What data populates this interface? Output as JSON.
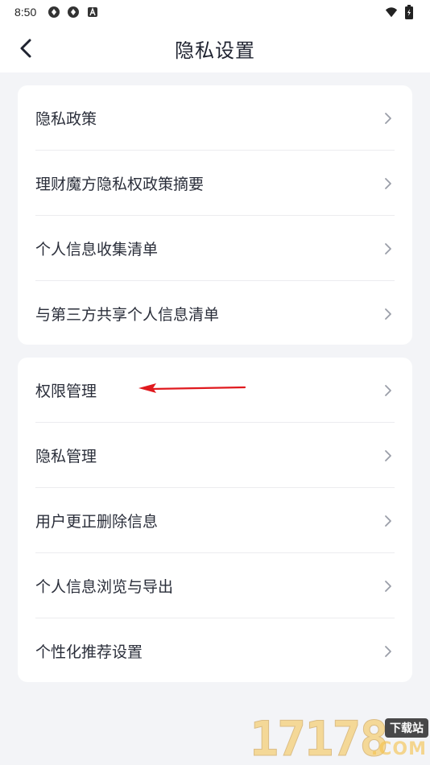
{
  "status_bar": {
    "time": "8:50",
    "left_icons": [
      "sync-icon",
      "sync-icon",
      "notification-a-icon"
    ],
    "right_icons": [
      "wifi-icon",
      "battery-icon"
    ]
  },
  "header": {
    "title": "隐私设置",
    "back_icon": "chevron-left-icon"
  },
  "groups": [
    {
      "items": [
        {
          "label": "隐私政策"
        },
        {
          "label": "理财魔方隐私权政策摘要"
        },
        {
          "label": "个人信息收集清单"
        },
        {
          "label": "与第三方共享个人信息清单"
        }
      ]
    },
    {
      "items": [
        {
          "label": "权限管理"
        },
        {
          "label": "隐私管理"
        },
        {
          "label": "用户更正删除信息"
        },
        {
          "label": "个人信息浏览与导出"
        },
        {
          "label": "个性化推荐设置"
        }
      ]
    }
  ],
  "annotation": {
    "color": "#e0191e"
  },
  "watermark": {
    "number": "17178",
    "badge": "下载站",
    "suffix": ".COM"
  },
  "colors": {
    "background": "#f3f4f7",
    "card": "#ffffff",
    "text": "#2a2e3a",
    "chevron": "#9a9ea8"
  }
}
